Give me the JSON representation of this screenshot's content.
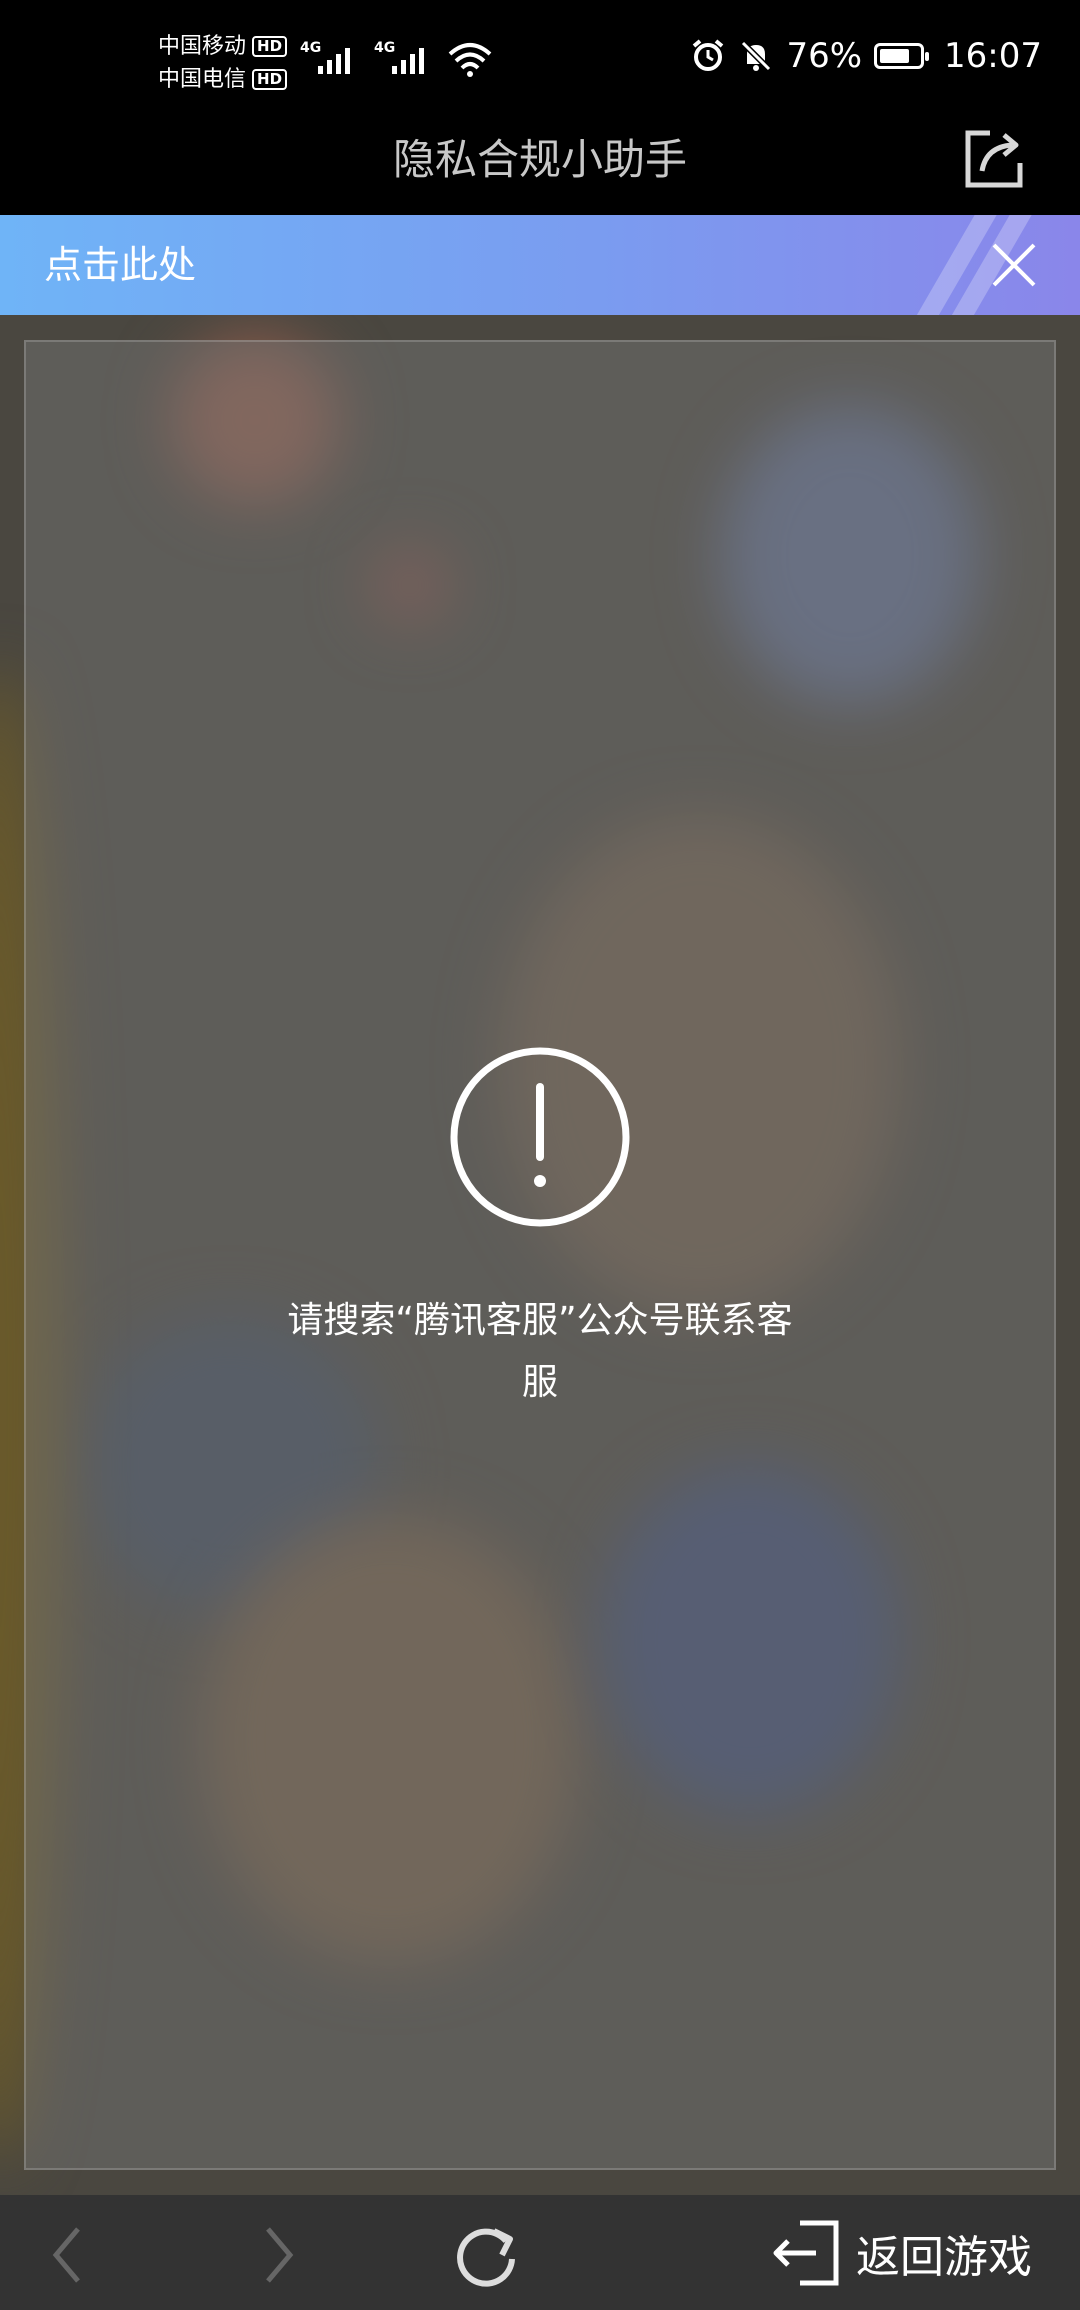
{
  "status_bar": {
    "carrier1": "中国移动",
    "carrier2": "中国电信",
    "hd_badge": "HD",
    "network1": "4G",
    "network2": "4G",
    "battery_percent": "76%",
    "battery_level": 0.76,
    "time": "16:07",
    "icons": [
      "alarm-icon",
      "mute-icon",
      "wifi-icon",
      "battery-icon"
    ]
  },
  "header": {
    "title": "隐私合规小助手",
    "share_icon": "share-icon"
  },
  "banner": {
    "text": "点击此处",
    "close_icon": "close-icon"
  },
  "main": {
    "alert_icon": "exclamation-circle-icon",
    "message": "请搜索“腾讯客服”公众号联系客服"
  },
  "bottom_nav": {
    "back_icon": "chevron-left-icon",
    "forward_icon": "chevron-right-icon",
    "refresh_icon": "refresh-icon",
    "return_icon": "exit-icon",
    "return_label": "返回游戏"
  }
}
